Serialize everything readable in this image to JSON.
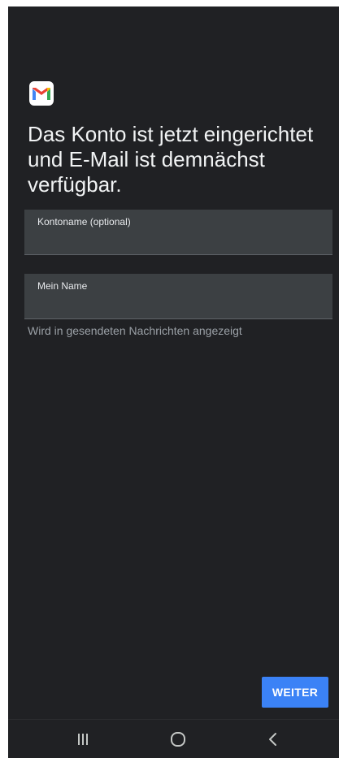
{
  "app": {
    "logo_icon": "gmail-icon"
  },
  "setup": {
    "headline": "Das Konto ist jetzt eingerichtet\nund E-Mail ist demnächst\nverfügbar.",
    "account_name_label": "Kontoname (optional)",
    "account_name_value": "",
    "my_name_label": "Mein Name",
    "my_name_value": "",
    "helper_text": "Wird in gesendeten Nachrichten angezeigt",
    "continue_label": "WEITER"
  },
  "navigation": {
    "recent_icon": "recent-apps-icon",
    "home_icon": "home-icon",
    "back_icon": "back-icon"
  },
  "colors": {
    "background": "#202124",
    "field_background": "#3c4043",
    "accent": "#3b82f6",
    "gmail_red": "#ea4335",
    "gmail_blue": "#4285f4",
    "gmail_green": "#34a853",
    "gmail_yellow": "#fbbc04"
  }
}
